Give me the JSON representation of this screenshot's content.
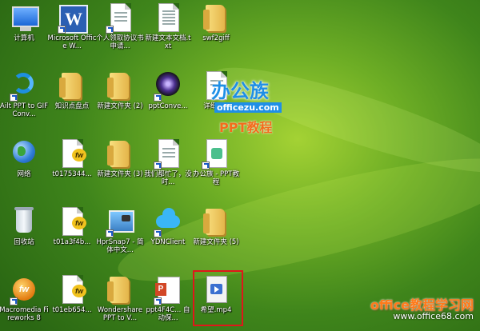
{
  "desktop": {
    "icons": {
      "computer": "计算机",
      "word": "Microsoft Office W...",
      "personal_funds": "个人领取协议书申请...",
      "new_txt": "新建文本文档.txt",
      "swf2giff": "swf2giff",
      "ailt": "Ailt PPT to GIF Conv...",
      "knowledge": "知识点盘点",
      "new_folder_2": "新建文件夹 (2)",
      "pptconve": "pptConve...",
      "detail": "详细 txt",
      "network": "网络",
      "t0175344": "t0175344...",
      "new_folder_3": "新建文件夹 (3)",
      "women_busy": "我们都忙了，没时...",
      "bangongzu_ppt": "办公族 - PPT教程",
      "recycle": "回收站",
      "t01a3f4b": "t01a3f4b...",
      "hprsnap": "HprSnap7 - 简体中文...",
      "ydnclient": "YDNClient",
      "new_folder_5": "新建文件夹 (5)",
      "macromedia": "Macromedia Fireworks 8",
      "t01eb654": "t01eb654...",
      "wondershare": "Wondershare PPT to V...",
      "ppt4f4c": "ppt4F4C... 自动保...",
      "hope_mp4": "希望.mp4"
    },
    "selected_icon": "hope_mp4"
  },
  "watermark": {
    "logo_top": "办公族",
    "logo_url": "officezu.com",
    "logo_bottom": "PPT教程",
    "footer_title": "office教程学习网",
    "footer_url": "www.office68.com"
  },
  "colors": {
    "background": "#4f961e",
    "selection_border": "#e0161a",
    "footer_title": "#ff7a1a",
    "logo_blue": "#1f8fe6"
  }
}
